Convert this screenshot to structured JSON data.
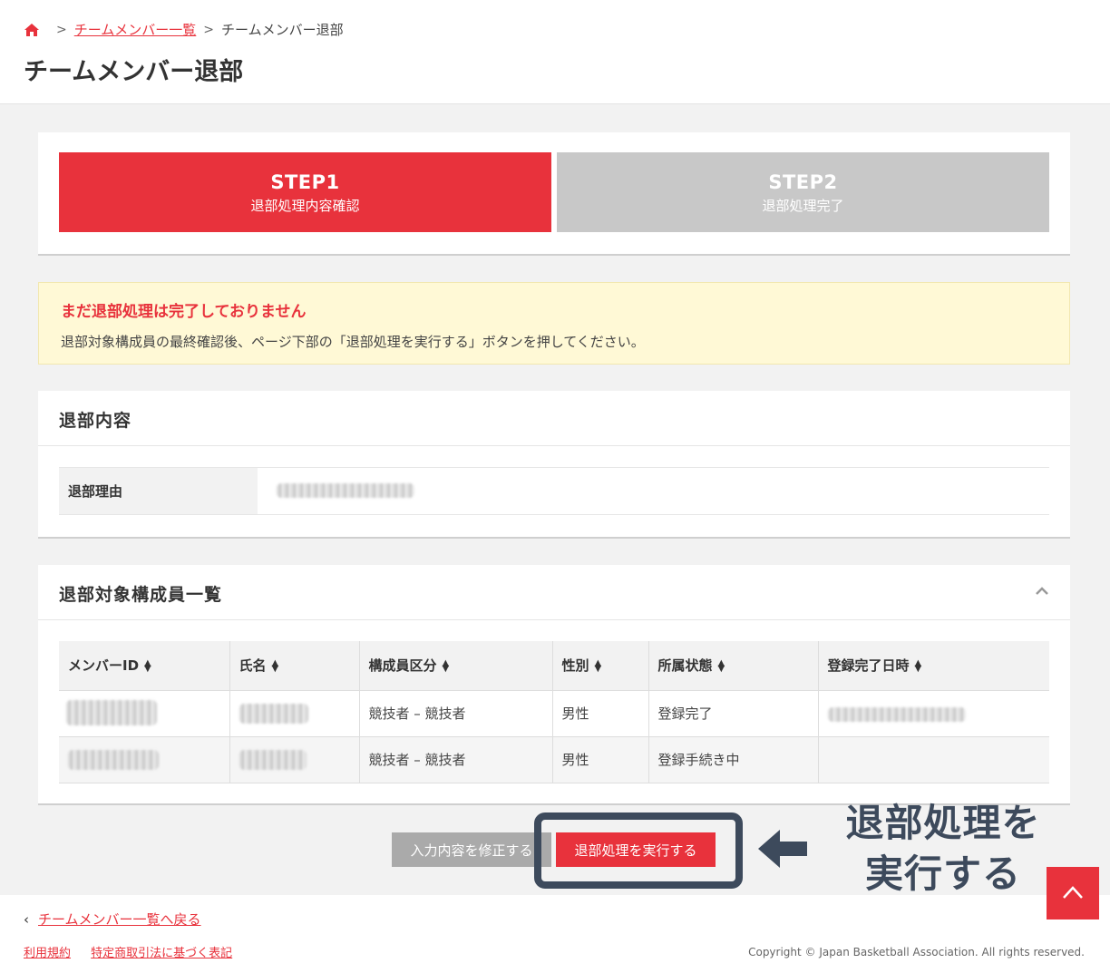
{
  "breadcrumb": {
    "home_icon": "home-icon",
    "link": "チームメンバー一覧",
    "current": "チームメンバー退部"
  },
  "page_title": "チームメンバー退部",
  "steps": [
    {
      "title": "STEP1",
      "label": "退部処理内容確認",
      "active": true
    },
    {
      "title": "STEP2",
      "label": "退部処理完了",
      "active": false
    }
  ],
  "notice": {
    "title": "まだ退部処理は完了しておりません",
    "body": "退部対象構成員の最終確認後、ページ下部の「退部処理を実行する」ボタンを押してください。"
  },
  "detail": {
    "heading": "退部内容",
    "reason_label": "退部理由"
  },
  "members": {
    "heading": "退部対象構成員一覧",
    "columns": [
      "メンバーID",
      "氏名",
      "構成員区分",
      "性別",
      "所属状態",
      "登録完了日時"
    ],
    "rows": [
      {
        "category": "競技者 – 競技者",
        "gender": "男性",
        "status": "登録完了"
      },
      {
        "category": "競技者 – 競技者",
        "gender": "男性",
        "status": "登録手続き中"
      }
    ]
  },
  "buttons": {
    "edit": "入力内容を修正する",
    "execute": "退部処理を実行する"
  },
  "annotation": {
    "line1": "退部処理を",
    "line2": "実行する"
  },
  "footer": {
    "back": "チームメンバー一覧へ戻る",
    "links": [
      "利用規約",
      "特定商取引法に基づく表記"
    ],
    "copyright": "Copyright © Japan Basketball Association. All rights reserved."
  },
  "colors": {
    "accent": "#e8323c",
    "annotation": "#3d4a5c"
  }
}
